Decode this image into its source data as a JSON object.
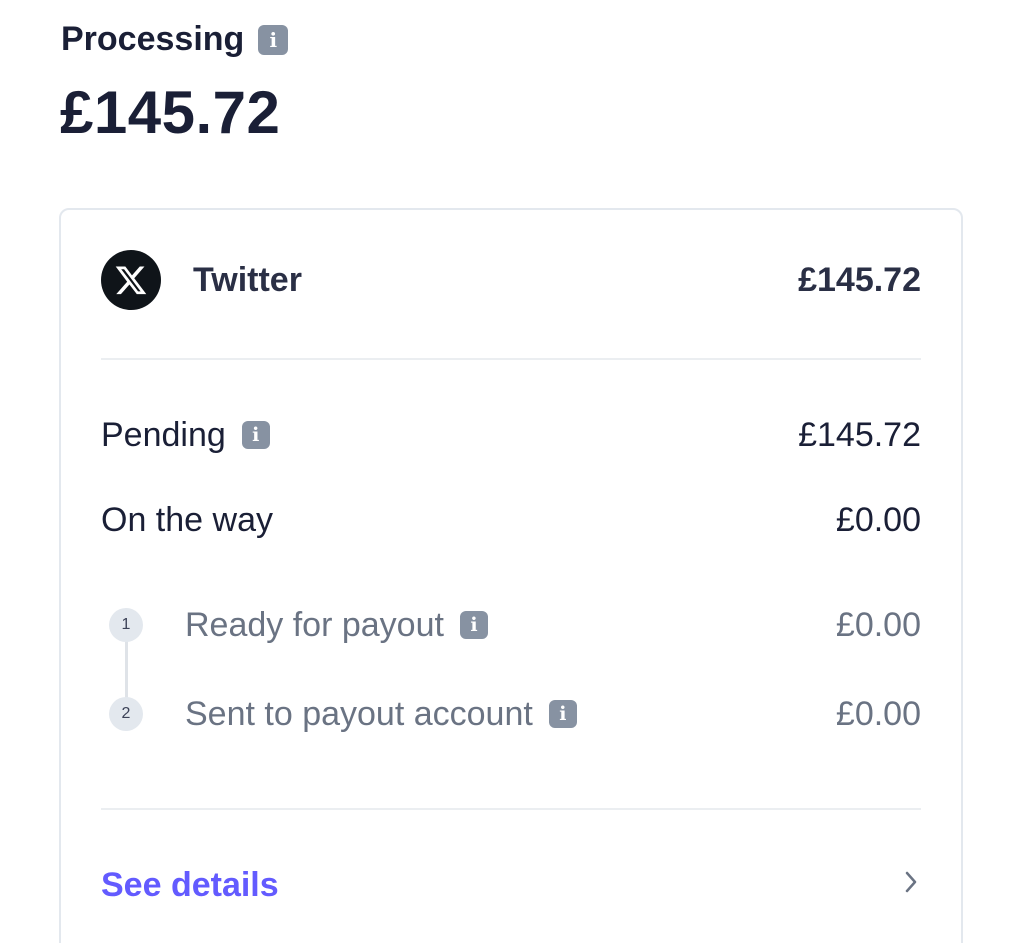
{
  "header": {
    "title": "Processing",
    "total": "£145.72"
  },
  "account": {
    "name": "Twitter",
    "amount": "£145.72",
    "logo_icon": "x-logo-icon"
  },
  "breakdown": {
    "pending_label": "Pending",
    "pending_amount": "£145.72",
    "on_the_way_label": "On the way",
    "on_the_way_amount": "£0.00"
  },
  "steps": [
    {
      "number": "1",
      "label": "Ready for payout",
      "amount": "£0.00"
    },
    {
      "number": "2",
      "label": "Sent to payout account",
      "amount": "£0.00"
    }
  ],
  "footer": {
    "link_label": "See details",
    "chevron_icon": "chevron-right-icon"
  },
  "info_glyph": "i",
  "colors": {
    "text": "#1a1f36",
    "muted": "#6a7383",
    "link": "#635bff",
    "badge": "#8792a2"
  }
}
